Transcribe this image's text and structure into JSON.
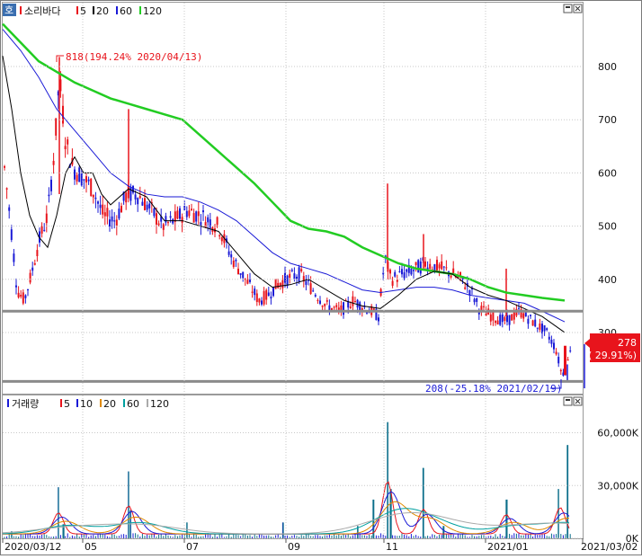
{
  "price_panel": {
    "badge": "호",
    "title": "소리바다",
    "legend": [
      {
        "label": "5",
        "color": "#e8141c"
      },
      {
        "label": "20",
        "color": "#000000"
      },
      {
        "label": "60",
        "color": "#1a1ad6"
      },
      {
        "label": "120",
        "color": "#22cc22"
      }
    ],
    "high_annotation": "818(194.24% 2020/04/13)",
    "low_annotation": "208(-25.18% 2021/02/19)",
    "current_price": "278",
    "current_change": "( 29.91%)"
  },
  "volume_panel": {
    "title": "거래량",
    "legend": [
      {
        "label": "5",
        "color": "#e8141c"
      },
      {
        "label": "10",
        "color": "#1a1ad6"
      },
      {
        "label": "20",
        "color": "#e08a00"
      },
      {
        "label": "60",
        "color": "#00a0a0"
      },
      {
        "label": "120",
        "color": "#aaaaaa"
      }
    ]
  },
  "x_axis": {
    "labels": [
      "2020/03/12",
      "05",
      "07",
      "09",
      "11",
      "2021/01",
      "2021/03/02"
    ]
  },
  "colors": {
    "up": "#e8141c",
    "down": "#1a1ad6",
    "ma5": "#000000",
    "ma20": "#000000",
    "ma60": "#1a1ad6",
    "ma120": "#22cc22"
  },
  "chart_data": [
    {
      "type": "line",
      "title": "소리바다",
      "yticks": [
        300,
        400,
        500,
        600,
        700,
        800
      ],
      "ylim": [
        185,
        920
      ],
      "horizontal_lines": [
        340,
        208
      ],
      "series": [
        {
          "name": "120",
          "color": "#22cc22",
          "points": [
            [
              0,
              880
            ],
            [
              20,
              845
            ],
            [
              40,
              810
            ],
            [
              60,
              790
            ],
            [
              80,
              770
            ],
            [
              100,
              755
            ],
            [
              120,
              740
            ],
            [
              140,
              730
            ],
            [
              160,
              720
            ],
            [
              180,
              710
            ],
            [
              200,
              700
            ],
            [
              220,
              670
            ],
            [
              240,
              640
            ],
            [
              260,
              610
            ],
            [
              280,
              580
            ],
            [
              300,
              545
            ],
            [
              320,
              510
            ],
            [
              340,
              495
            ],
            [
              360,
              490
            ],
            [
              380,
              480
            ],
            [
              400,
              460
            ],
            [
              420,
              445
            ],
            [
              440,
              430
            ],
            [
              460,
              420
            ],
            [
              480,
              415
            ],
            [
              500,
              410
            ],
            [
              520,
              400
            ],
            [
              540,
              385
            ],
            [
              560,
              375
            ],
            [
              580,
              370
            ],
            [
              600,
              365
            ],
            [
              625,
              360
            ]
          ]
        },
        {
          "name": "60",
          "color": "#1a1ad6",
          "points": [
            [
              0,
              870
            ],
            [
              20,
              830
            ],
            [
              40,
              780
            ],
            [
              60,
              720
            ],
            [
              80,
              680
            ],
            [
              100,
              640
            ],
            [
              120,
              600
            ],
            [
              140,
              575
            ],
            [
              160,
              560
            ],
            [
              180,
              555
            ],
            [
              200,
              555
            ],
            [
              220,
              545
            ],
            [
              240,
              530
            ],
            [
              260,
              510
            ],
            [
              280,
              480
            ],
            [
              300,
              450
            ],
            [
              320,
              430
            ],
            [
              340,
              420
            ],
            [
              360,
              410
            ],
            [
              380,
              395
            ],
            [
              400,
              380
            ],
            [
              420,
              375
            ],
            [
              440,
              380
            ],
            [
              460,
              385
            ],
            [
              480,
              385
            ],
            [
              500,
              380
            ],
            [
              520,
              370
            ],
            [
              540,
              365
            ],
            [
              560,
              360
            ],
            [
              580,
              355
            ],
            [
              600,
              340
            ],
            [
              625,
              320
            ]
          ]
        },
        {
          "name": "20",
          "color": "#000000",
          "points": [
            [
              0,
              820
            ],
            [
              10,
              720
            ],
            [
              20,
              600
            ],
            [
              30,
              520
            ],
            [
              40,
              480
            ],
            [
              50,
              460
            ],
            [
              60,
              520
            ],
            [
              70,
              600
            ],
            [
              80,
              630
            ],
            [
              90,
              600
            ],
            [
              100,
              600
            ],
            [
              110,
              560
            ],
            [
              120,
              540
            ],
            [
              140,
              570
            ],
            [
              160,
              555
            ],
            [
              180,
              510
            ],
            [
              200,
              510
            ],
            [
              220,
              500
            ],
            [
              240,
              490
            ],
            [
              260,
              450
            ],
            [
              280,
              410
            ],
            [
              300,
              385
            ],
            [
              320,
              390
            ],
            [
              340,
              400
            ],
            [
              360,
              380
            ],
            [
              380,
              360
            ],
            [
              400,
              350
            ],
            [
              420,
              345
            ],
            [
              440,
              370
            ],
            [
              460,
              400
            ],
            [
              480,
              415
            ],
            [
              500,
              410
            ],
            [
              520,
              385
            ],
            [
              540,
              370
            ],
            [
              560,
              360
            ],
            [
              580,
              345
            ],
            [
              600,
              330
            ],
            [
              625,
              300
            ]
          ]
        }
      ]
    },
    {
      "type": "bar",
      "title": "거래량",
      "yticks": [
        0,
        30000,
        60000
      ],
      "ytick_labels": [
        "0K",
        "30,000K",
        "60,000K"
      ],
      "ylim": [
        0,
        72000
      ],
      "peaks": [
        [
          10,
          4000
        ],
        [
          62,
          29000
        ],
        [
          68,
          8000
        ],
        [
          140,
          38000
        ],
        [
          142,
          16000
        ],
        [
          205,
          9000
        ],
        [
          312,
          9000
        ],
        [
          395,
          7000
        ],
        [
          412,
          22000
        ],
        [
          428,
          66000
        ],
        [
          432,
          28000
        ],
        [
          468,
          40000
        ],
        [
          490,
          7000
        ],
        [
          560,
          22000
        ],
        [
          618,
          28000
        ],
        [
          628,
          53000
        ]
      ]
    }
  ]
}
